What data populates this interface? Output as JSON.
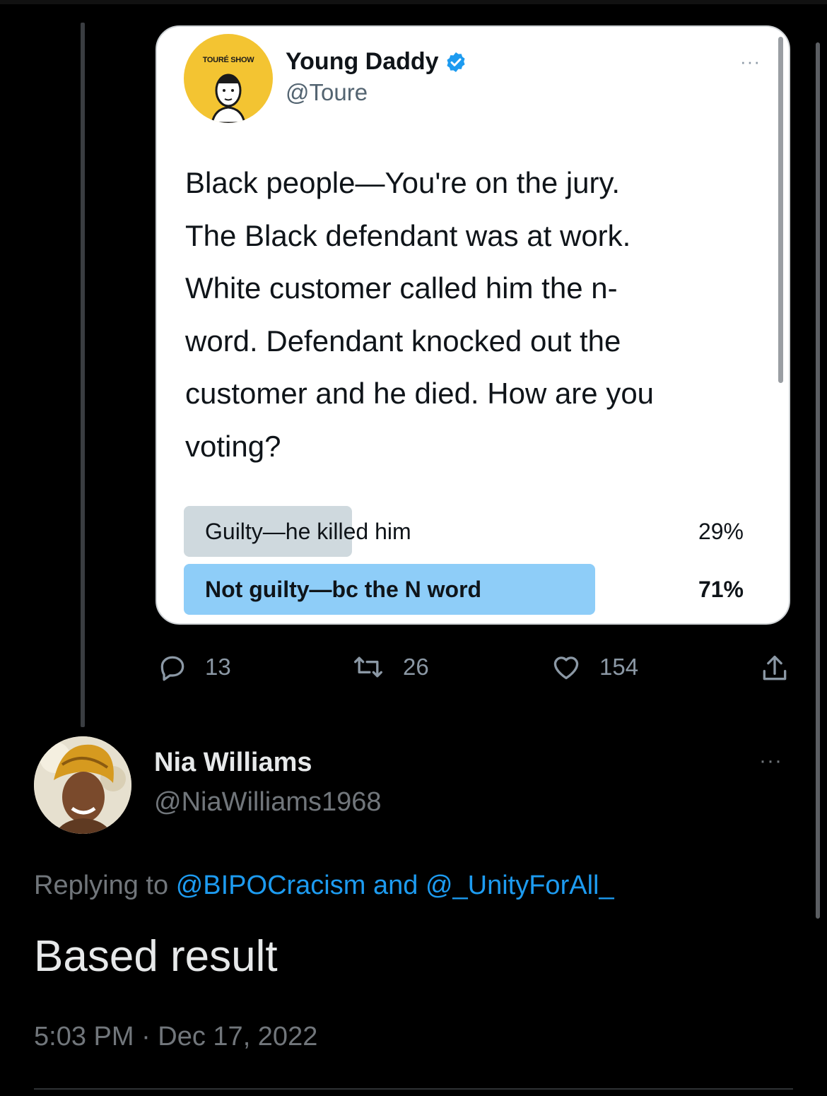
{
  "quoted_tweet": {
    "show_label": "TOURÉ SHOW",
    "author_name": "Young Daddy",
    "author_handle": "@Toure",
    "more_label": "···",
    "text": "Black people—You're on the jury. The Black defendant was at work. White customer called him the n-word. Defendant knocked out the customer and he died. How are you voting?",
    "text_lines": [
      "Black people—You're on the jury.",
      "The Black defendant was at work.",
      "White customer called him the n-",
      "word. Defendant knocked out the",
      "customer and he died. How are you",
      "voting?"
    ],
    "poll": [
      {
        "label": "Guilty—he killed him",
        "percent_label": "29%",
        "percent": 29,
        "winner": false,
        "bar_color": "#cfd9de"
      },
      {
        "label": "Not guilty—bc the N word",
        "percent_label": "71%",
        "percent": 71,
        "winner": true,
        "bar_color": "#8ecdf8"
      }
    ]
  },
  "actions": {
    "replies": "13",
    "retweets": "26",
    "likes": "154"
  },
  "reply": {
    "author_name": "Nia Williams",
    "author_handle": "@NiaWilliams1968",
    "more_label": "···",
    "replying_prefix": "Replying to",
    "mention_1": "@BIPOCracism",
    "and_word": "and",
    "mention_2": "@_UnityForAll_",
    "text": "Based result",
    "timestamp": "5:03 PM · Dec 17, 2022"
  },
  "colors": {
    "background": "#000000",
    "link": "#1d9bf0",
    "muted": "#71767b",
    "verified": "#1d9bf0"
  }
}
